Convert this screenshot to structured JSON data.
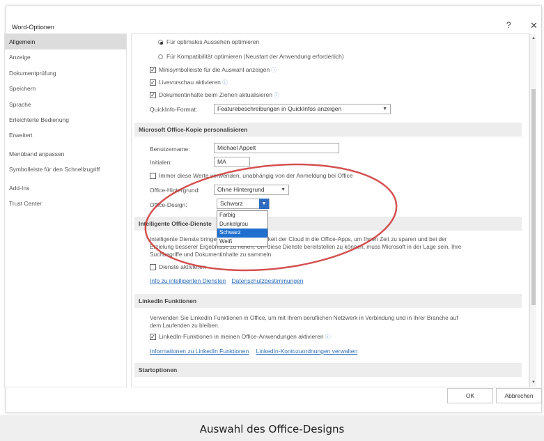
{
  "window": {
    "title": "Word-Optionen",
    "help_label": "?",
    "close_label": "✕"
  },
  "nav": {
    "items": [
      {
        "label": "Allgemein"
      },
      {
        "label": "Anzeige"
      },
      {
        "label": "Dokumentprüfung"
      },
      {
        "label": "Speichern"
      },
      {
        "label": "Sprache"
      },
      {
        "label": "Erleichterte Bedienung"
      },
      {
        "label": "Erweitert"
      },
      {
        "label": "Menüband anpassen"
      },
      {
        "label": "Symbolleiste für den Schnellzugriff"
      },
      {
        "label": "Add-Ins"
      },
      {
        "label": "Trust Center"
      }
    ]
  },
  "ui_options": {
    "radio_optimal": "Für optimales Aussehen optimieren",
    "radio_compat": "Für Kompatibilität optimieren (Neustart der Anwendung erforderlich)",
    "mini_toolbar": "Minisymbolleiste für die Auswahl anzeigen",
    "live_preview": "Livevorschau aktivieren",
    "update_drag": "Dokumentinhalte beim Ziehen aktualisieren",
    "screentip_label": "QuickInfo-Format:",
    "screentip_value": "Featurebeschreibungen in QuickInfos anzeigen"
  },
  "personalize": {
    "header": "Microsoft Office-Kopie personalisieren",
    "username_label": "Benutzername:",
    "username_value": "Michael Appelt",
    "initials_label": "Initialen:",
    "initials_value": "MA",
    "always_use": "Immer diese Werte verwenden, unabhängig von der Anmeldung bei Office",
    "background_label": "Office-Hintergrund:",
    "background_value": "Ohne Hintergrund",
    "design_label": "Office-Design:",
    "design_value": "Schwarz",
    "design_options": [
      "Farbig",
      "Dunkelgrau",
      "Schwarz",
      "Weiß"
    ]
  },
  "intelligent": {
    "header": "Intelligente Office-Dienste",
    "text_line1": "Intelligente Dienste bringen die Leistungsfähigkeit der Cloud in die Office-Apps, um Ihnen Zeit zu sparen und bei der",
    "text_line2": "Erzielung besserer Ergebnisse zu helfen. Um diese Dienste bereitstellen zu können, muss Microsoft in der Lage sein, Ihre",
    "text_line3": "Suchbegriffe und Dokumentinhalte zu sammeln.",
    "enable": "Dienste aktivieren",
    "link1": "Info zu intelligenten Diensten",
    "link2": "Datenschutzbestimmungen"
  },
  "linkedin": {
    "header": "LinkedIn Funktionen",
    "text_line1": "Verwenden Sie LinkedIn Funktionen in Office, um mit Ihrem beruflichen Netzwerk in Verbindung und in Ihrer Branche auf",
    "text_line2": "dem Laufenden zu bleiben.",
    "enable": "LinkedIn-Funktionen in meinen Office-Anwendungen aktivieren",
    "link1": "Informationen zu LinkedIn Funktionen",
    "link2": "LinkedIn-Kontozuordnungen verwalten"
  },
  "startup": {
    "header": "Startoptionen"
  },
  "buttons": {
    "ok": "OK",
    "cancel": "Abbrechen"
  },
  "caption": "Auswahl des Office-Designs",
  "colors": {
    "accent": "#2f6bbf",
    "highlight": "#1f6fcf",
    "annotation": "#cc3333"
  }
}
